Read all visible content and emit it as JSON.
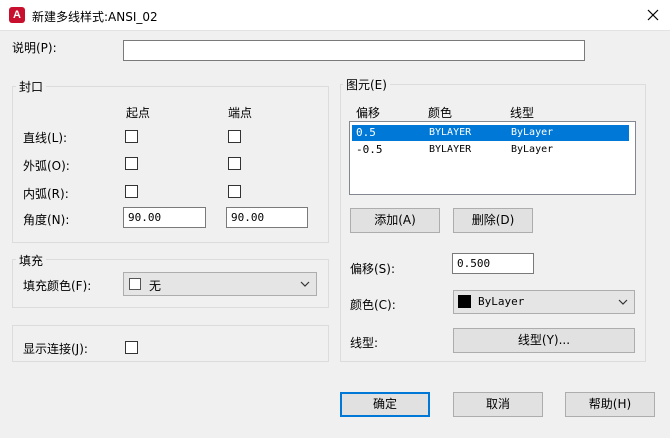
{
  "window": {
    "title": "新建多线样式:ANSI_02",
    "app_icon_letter": "A",
    "accent_color": "#c8102e"
  },
  "description": {
    "label": "说明(P):",
    "value": ""
  },
  "caps": {
    "legend": "封口",
    "col_start": "起点",
    "col_end": "端点",
    "rows": [
      {
        "label": "直线(L):",
        "start_checked": false,
        "end_checked": false
      },
      {
        "label": "外弧(O):",
        "start_checked": false,
        "end_checked": false
      },
      {
        "label": "内弧(R):",
        "start_checked": false,
        "end_checked": false
      }
    ],
    "angle_label": "角度(N):",
    "angle_start": "90.00",
    "angle_end": "90.00"
  },
  "fill": {
    "legend": "填充",
    "color_label": "填充颜色(F):",
    "color_value": "无"
  },
  "display_joints": {
    "label": "显示连接(J):",
    "checked": false
  },
  "elements": {
    "legend": "图元(E)",
    "columns": [
      "偏移",
      "颜色",
      "线型"
    ],
    "rows": [
      {
        "offset": "0.5",
        "color": "BYLAYER",
        "linetype": "ByLayer",
        "selected": true
      },
      {
        "offset": "-0.5",
        "color": "BYLAYER",
        "linetype": "ByLayer",
        "selected": false
      }
    ],
    "add_button": "添加(A)",
    "delete_button": "删除(D)",
    "offset_label": "偏移(S):",
    "offset_value": "0.500",
    "color_label": "颜色(C):",
    "color_value": "ByLayer",
    "color_swatch": "#000000",
    "linetype_label": "线型:",
    "linetype_button": "线型(Y)..."
  },
  "footer": {
    "ok": "确定",
    "cancel": "取消",
    "help": "帮助(H)"
  },
  "selection_color": "#0078d7"
}
